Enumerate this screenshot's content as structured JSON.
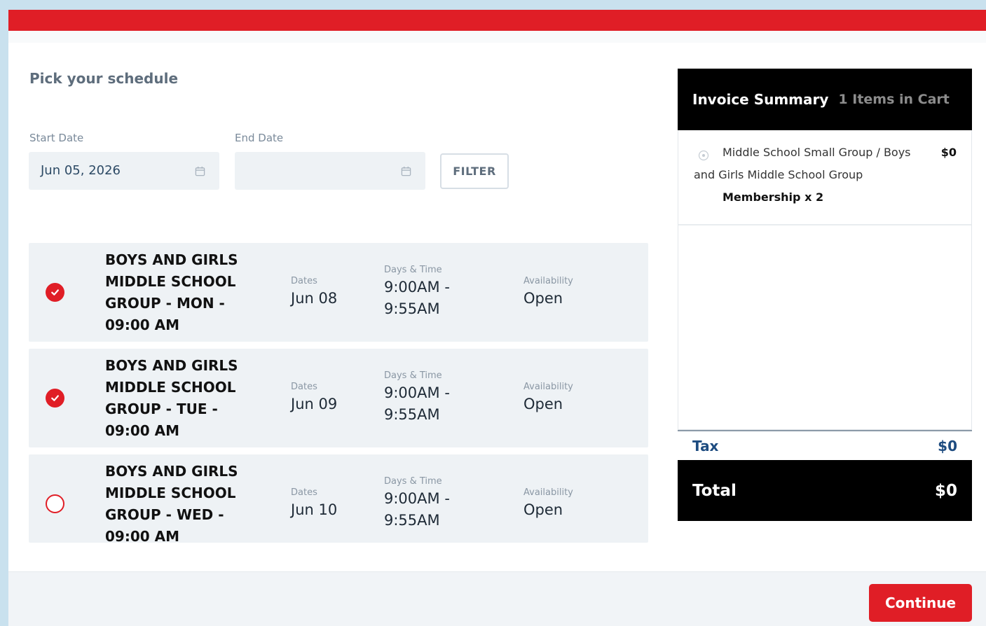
{
  "page": {
    "title": "Pick your schedule"
  },
  "filters": {
    "start_label": "Start Date",
    "start_value": "Jun 05, 2026",
    "end_label": "End Date",
    "end_value": "",
    "filter_button": "FILTER"
  },
  "sessions": [
    {
      "name": "BOYS AND GIRLS MIDDLE SCHOOL GROUP - MON - 09:00 AM",
      "dates_label": "Dates",
      "date": "Jun 08",
      "time_label": "Days & Time",
      "time": "9:00AM - 9:55AM",
      "avail_label": "Availability",
      "availability": "Open",
      "selected": true
    },
    {
      "name": "BOYS AND GIRLS MIDDLE SCHOOL GROUP - TUE - 09:00 AM",
      "dates_label": "Dates",
      "date": "Jun 09",
      "time_label": "Days & Time",
      "time": "9:00AM - 9:55AM",
      "avail_label": "Availability",
      "availability": "Open",
      "selected": true
    },
    {
      "name": "BOYS AND GIRLS MIDDLE SCHOOL GROUP - WED - 09:00 AM",
      "dates_label": "Dates",
      "date": "Jun 10",
      "time_label": "Days & Time",
      "time": "9:00AM - 9:55AM",
      "avail_label": "Availability",
      "availability": "Open",
      "selected": false
    }
  ],
  "invoice": {
    "title": "Invoice Summary",
    "count": "1 Items in Cart",
    "item": {
      "line1": "Middle School Small Group / Boys",
      "line2": "and Girls Middle School Group",
      "line3": "Membership x 2",
      "price": "$0"
    },
    "tax_label": "Tax",
    "tax_value": "$0",
    "total_label": "Total",
    "total_value": "$0"
  },
  "footer": {
    "continue_label": "Continue"
  },
  "colors": {
    "accent": "#e01e26",
    "panel": "#eef2f5",
    "dark": "#000000",
    "link": "#1e4c80"
  },
  "icons": {
    "date": "calendar-icon",
    "selected": "check-icon",
    "remove": "remove-icon"
  }
}
